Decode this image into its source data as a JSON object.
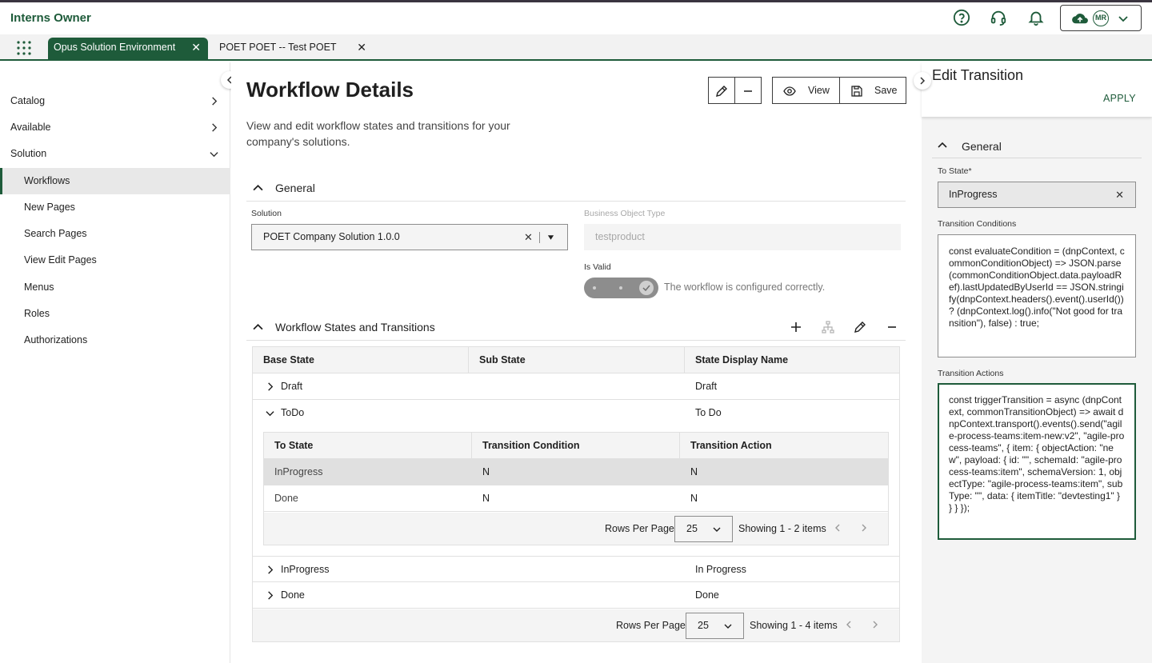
{
  "app": {
    "title": "Interns Owner"
  },
  "tabs": [
    {
      "label": "Opus Solution Environment",
      "active": true
    },
    {
      "label": "POET POET -- Test POET",
      "active": false
    }
  ],
  "account": {
    "initials": "MR"
  },
  "sidebar": {
    "items": [
      {
        "label": "Catalog",
        "expandable": true
      },
      {
        "label": "Available",
        "expandable": true
      },
      {
        "label": "Solution",
        "expanded": true
      }
    ],
    "subitems": [
      {
        "label": "Workflows",
        "selected": true
      },
      {
        "label": "New Pages"
      },
      {
        "label": "Search Pages"
      },
      {
        "label": "View Edit Pages"
      },
      {
        "label": "Menus"
      },
      {
        "label": "Roles"
      },
      {
        "label": "Authorizations"
      }
    ]
  },
  "main": {
    "title": "Workflow Details",
    "description": "View and edit workflow states and transitions for your company's solutions.",
    "toolbar": {
      "view_label": "View",
      "save_label": "Save"
    },
    "general": {
      "title": "General",
      "solution_label": "Solution",
      "solution_value": "POET Company Solution 1.0.0",
      "bo_type_label": "Business Object Type",
      "bo_type_value": "testproduct",
      "is_valid_label": "Is Valid",
      "valid_message": "The workflow is configured correctly."
    },
    "states": {
      "title": "Workflow States and Transitions",
      "columns": [
        "Base State",
        "Sub State",
        "State Display Name"
      ],
      "rows": [
        {
          "base": "Draft",
          "sub": "",
          "display": "Draft",
          "expanded": false
        },
        {
          "base": "ToDo",
          "sub": "",
          "display": "To Do",
          "expanded": true
        },
        {
          "base": "InProgress",
          "sub": "",
          "display": "In Progress",
          "expanded": false
        },
        {
          "base": "Done",
          "sub": "",
          "display": "Done",
          "expanded": false
        }
      ],
      "transitions": {
        "columns": [
          "To State",
          "Transition Condition",
          "Transition Action"
        ],
        "rows": [
          {
            "to": "InProgress",
            "condition": "N",
            "action": "N",
            "selected": true
          },
          {
            "to": "Done",
            "condition": "N",
            "action": "N",
            "selected": false
          }
        ],
        "pager": {
          "rows_per_page_label": "Rows Per Page",
          "rows_per_page": "25",
          "showing": "Showing 1 - 2 items"
        }
      },
      "pager": {
        "rows_per_page_label": "Rows Per Page",
        "rows_per_page": "25",
        "showing": "Showing 1 - 4 items"
      }
    }
  },
  "panel": {
    "title": "Edit Transition",
    "apply_label": "APPLY",
    "section_title": "General",
    "to_state_label": "To State*",
    "to_state_value": "InProgress",
    "conditions_label": "Transition Conditions",
    "conditions_value": "const evaluateCondition = (dnpContext, commonConditionObject) => JSON.parse(commonConditionObject.data.payloadRef).lastUpdatedByUserId == JSON.stringify(dnpContext.headers().event().userId()) ? (dnpContext.log().info(\"Not good for transition\"), false) : true;",
    "actions_label": "Transition Actions",
    "actions_value": "const triggerTransition = async (dnpContext, commonTransitionObject) => await dnpContext.transport().events().send(\"agile-process-teams:item-new:v2\", \"agile-process-teams\", { item: { objectAction: \"new\", payload: { id: \"\", schemaId: \"agile-process-teams:item\", schemaVersion: 1, objectType: \"agile-process-teams:item\", subType: \"\", data: { itemTitle: \"devtesting1\" } } } });"
  },
  "colors": {
    "brand": "#1e5b3a",
    "selected_row": "#e0e0e0",
    "panel_bg": "#f4f4f4"
  },
  "icons": [
    "help-icon",
    "support-headset-icon",
    "bell-icon",
    "cloud-icon",
    "apps-grid-icon",
    "pencil-icon",
    "minus-icon",
    "eye-icon",
    "save-icon",
    "plus-icon",
    "hierarchy-icon",
    "chevron-icon",
    "close-icon"
  ]
}
